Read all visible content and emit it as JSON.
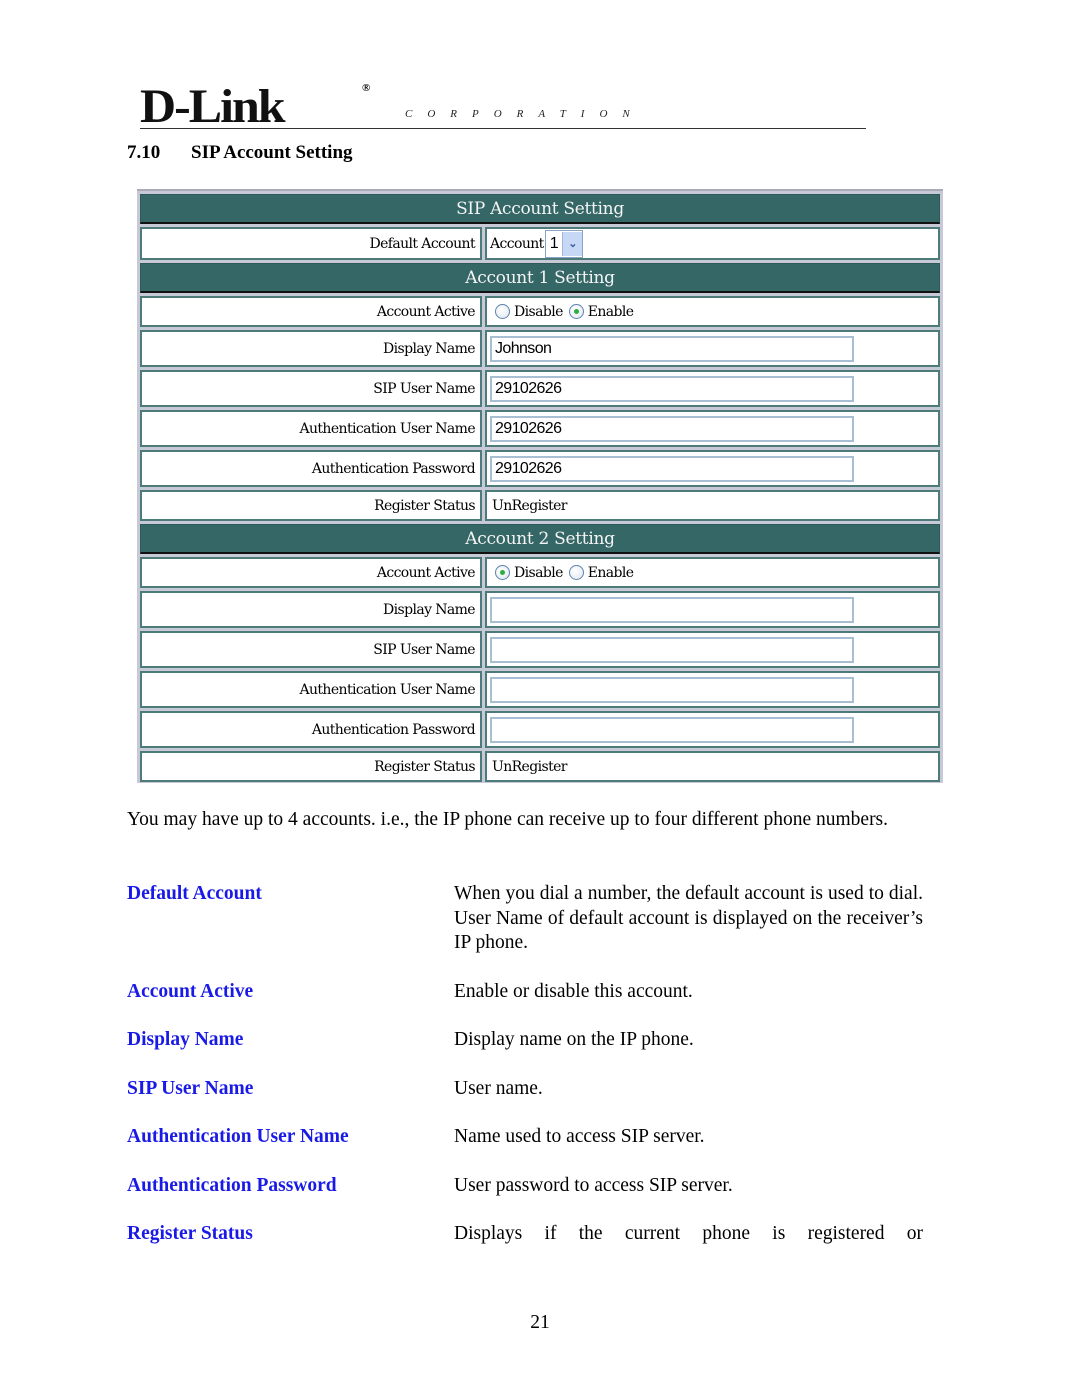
{
  "header": {
    "logo_text": "D-Link",
    "logo_reg": "®",
    "logo_sub": "CORPORATION",
    "section_number": "7.10",
    "section_title": "SIP Account Setting"
  },
  "ui": {
    "title": "SIP Account Setting",
    "default_account": {
      "label": "Default Account",
      "prefix": "Account",
      "selected": "1"
    },
    "accounts": [
      {
        "header": "Account 1 Setting",
        "active_label": "Account Active",
        "options": [
          "Disable",
          "Enable"
        ],
        "active": "Enable",
        "fields": [
          {
            "label": "Display Name",
            "value": "Johnson"
          },
          {
            "label": "SIP User Name",
            "value": "29102626"
          },
          {
            "label": "Authentication User Name",
            "value": "29102626"
          },
          {
            "label": "Authentication Password",
            "value": "29102626"
          }
        ],
        "status_label": "Register Status",
        "status": "UnRegister"
      },
      {
        "header": "Account 2 Setting",
        "active_label": "Account Active",
        "options": [
          "Disable",
          "Enable"
        ],
        "active": "Disable",
        "fields": [
          {
            "label": "Display Name",
            "value": ""
          },
          {
            "label": "SIP User Name",
            "value": ""
          },
          {
            "label": "Authentication User Name",
            "value": ""
          },
          {
            "label": "Authentication Password",
            "value": ""
          }
        ],
        "status_label": "Register Status",
        "status": "UnRegister"
      }
    ]
  },
  "body": {
    "intro": "You may have up to 4 accounts. i.e., the IP phone can receive up to four different phone numbers.",
    "definitions": [
      {
        "term": "Default Account",
        "desc": "When you dial a number, the default account is used to dial. User Name of default account is displayed on the receiver’s IP phone."
      },
      {
        "term": "Account Active",
        "desc": "Enable or disable this account."
      },
      {
        "term": "Display Name",
        "desc": "Display name on the IP phone."
      },
      {
        "term": "SIP User Name",
        "desc": "User name."
      },
      {
        "term": "Authentication User Name",
        "desc": "Name used to access SIP server."
      },
      {
        "term": "Authentication Password",
        "desc": "User password to access SIP server."
      },
      {
        "term": "Register Status",
        "desc": "Displays if the current phone is registered or"
      }
    ]
  },
  "footer": {
    "page_number": "21"
  },
  "colors": {
    "header_bar": "#346766",
    "term_blue": "#1a1ae6",
    "radio_selected": "#2cae3e"
  }
}
